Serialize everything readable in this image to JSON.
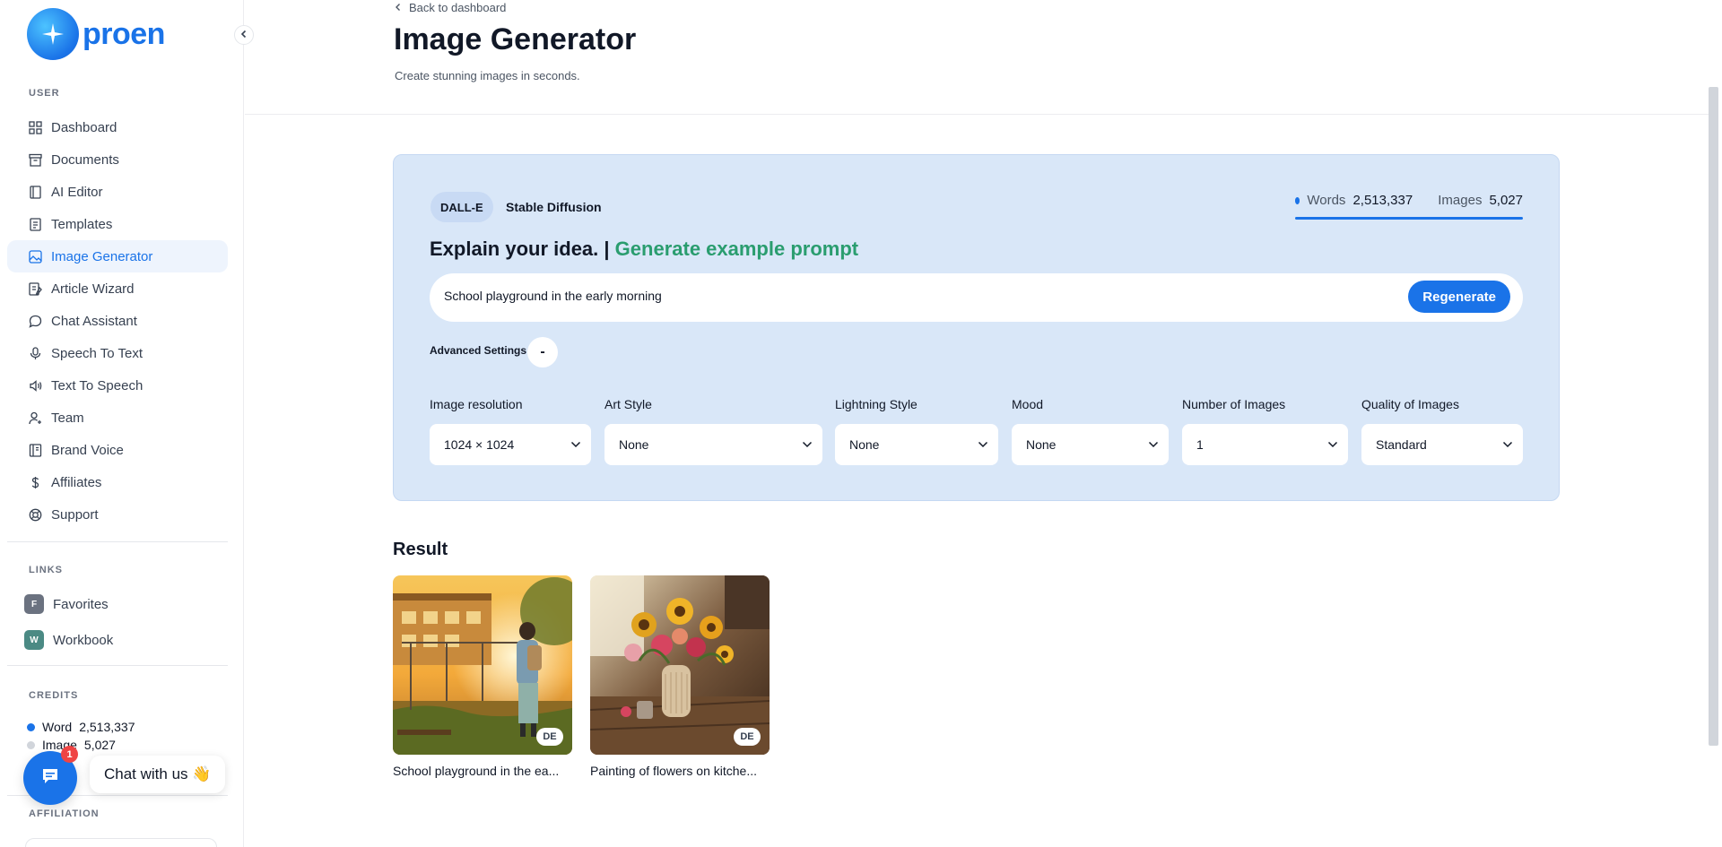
{
  "brand": {
    "name": "proen",
    "accent": "#1a73e8"
  },
  "sidebar": {
    "user_section": "USER",
    "items": [
      {
        "label": "Dashboard",
        "icon": "grid-icon"
      },
      {
        "label": "Documents",
        "icon": "archive-icon"
      },
      {
        "label": "AI Editor",
        "icon": "notebook-icon"
      },
      {
        "label": "Templates",
        "icon": "document-icon"
      },
      {
        "label": "Image Generator",
        "icon": "image-icon",
        "active": true
      },
      {
        "label": "Article Wizard",
        "icon": "article-icon"
      },
      {
        "label": "Chat Assistant",
        "icon": "chat-icon"
      },
      {
        "label": "Speech To Text",
        "icon": "microphone-icon"
      },
      {
        "label": "Text To Speech",
        "icon": "speaker-icon"
      },
      {
        "label": "Team",
        "icon": "user-plus-icon"
      },
      {
        "label": "Brand Voice",
        "icon": "book-icon"
      },
      {
        "label": "Affiliates",
        "icon": "dollar-icon"
      },
      {
        "label": "Support",
        "icon": "lifebuoy-icon"
      }
    ],
    "links_section": "LINKS",
    "links": [
      {
        "badge": "F",
        "label": "Favorites",
        "color": "#6b7280"
      },
      {
        "badge": "W",
        "label": "Workbook",
        "color": "#4b8a84"
      }
    ],
    "credits_section": "CREDITS",
    "credits": {
      "word_label": "Word",
      "word_value": "2,513,337",
      "image_label": "Image",
      "image_value": "5,027"
    },
    "affiliation_section": "AFFILIATION"
  },
  "chat_widget": {
    "label": "Chat with us 👋",
    "unread": "1"
  },
  "header": {
    "back_label": "Back to dashboard",
    "title": "Image Generator",
    "subtitle": "Create stunning images in seconds."
  },
  "generator": {
    "engines": [
      "DALL-E",
      "Stable Diffusion"
    ],
    "usage": {
      "words_label": "Words",
      "words_value": "2,513,337",
      "images_label": "Images",
      "images_value": "5,027"
    },
    "idea_text": "Explain your idea. |",
    "example_link": "Generate example prompt",
    "prompt_value": "School playground in the early morning",
    "regenerate_label": "Regenerate",
    "advanced_label": "Advanced Settings",
    "advanced_toggle": "-",
    "fields": [
      {
        "label": "Image resolution",
        "value": "1024 × 1024"
      },
      {
        "label": "Art Style",
        "value": "None"
      },
      {
        "label": "Lightning Style",
        "value": "None"
      },
      {
        "label": "Mood",
        "value": "None"
      },
      {
        "label": "Number of Images",
        "value": "1"
      },
      {
        "label": "Quality of Images",
        "value": "Standard"
      }
    ]
  },
  "results": {
    "title": "Result",
    "items": [
      {
        "caption": "School playground in the ea...",
        "badge": "DE"
      },
      {
        "caption": "Painting of flowers on kitche...",
        "badge": "DE"
      }
    ]
  }
}
